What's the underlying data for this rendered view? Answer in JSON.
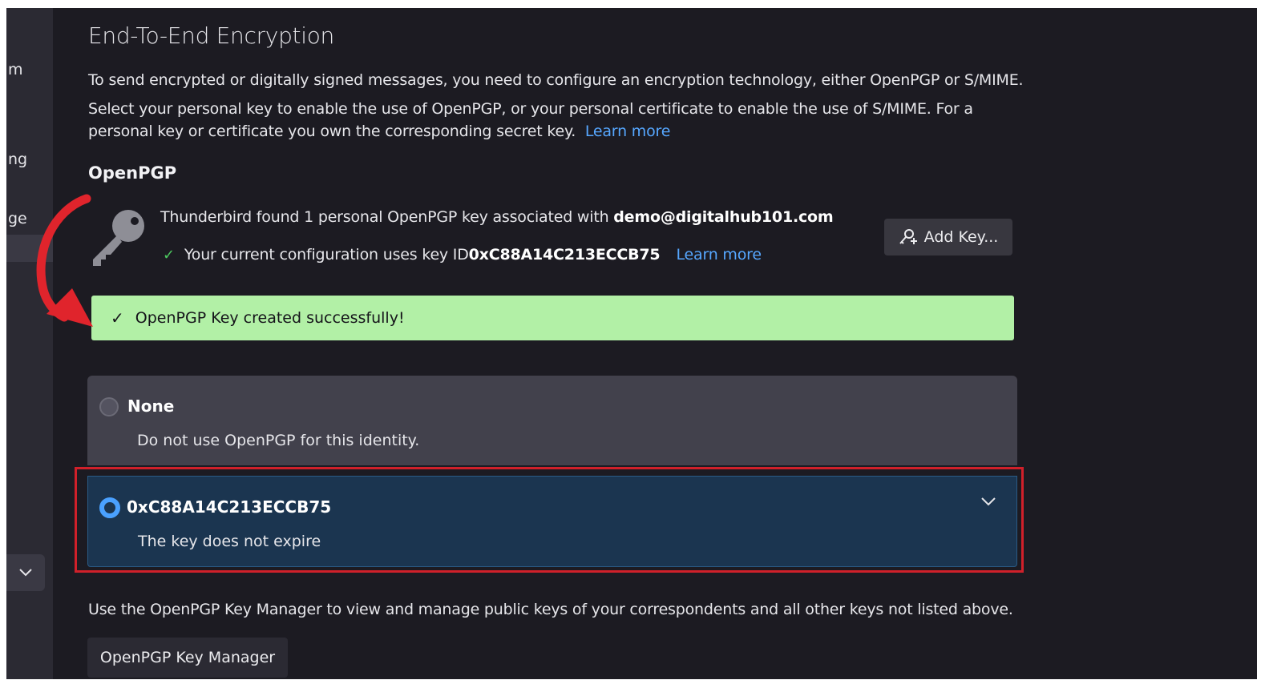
{
  "sidebar": {
    "fragments": [
      "m",
      "ng",
      "ge"
    ]
  },
  "section": {
    "title": "End-To-End Encryption",
    "intro": "To send encrypted or digitally signed messages, you need to configure an encryption technology, either OpenPGP or S/MIME.",
    "select_text": "Select your personal key to enable the use of OpenPGP, or your personal certificate to enable the use of S/MIME. For a personal key or certificate you own the corresponding secret key.",
    "learn_more": "Learn more"
  },
  "openpgp": {
    "heading": "OpenPGP",
    "found_prefix": "Thunderbird found 1 personal OpenPGP key associated with ",
    "email": "demo@digitalhub101.com",
    "config_prefix": "Your current configuration uses key ID ",
    "key_id": "0xC88A14C213ECCB75",
    "learn_more": "Learn more",
    "add_key_label": "Add Key...",
    "success_message": "OpenPGP Key created successfully!"
  },
  "options": {
    "none_title": "None",
    "none_desc": "Do not use OpenPGP for this identity.",
    "key_title": "0xC88A14C213ECCB75",
    "key_desc": "The key does not expire",
    "selected": "0xC88A14C213ECCB75"
  },
  "footer": {
    "text": "Use the OpenPGP Key Manager to view and manage public keys of your correspondents and all other keys not listed above.",
    "button_label": "OpenPGP Key Manager"
  },
  "colors": {
    "background": "#1c1b22",
    "link": "#56a7ff",
    "success": "#b2f0a6",
    "selected_option": "#1b3550",
    "highlight_box": "#d0202a",
    "annotation_arrow": "#e0242c"
  }
}
